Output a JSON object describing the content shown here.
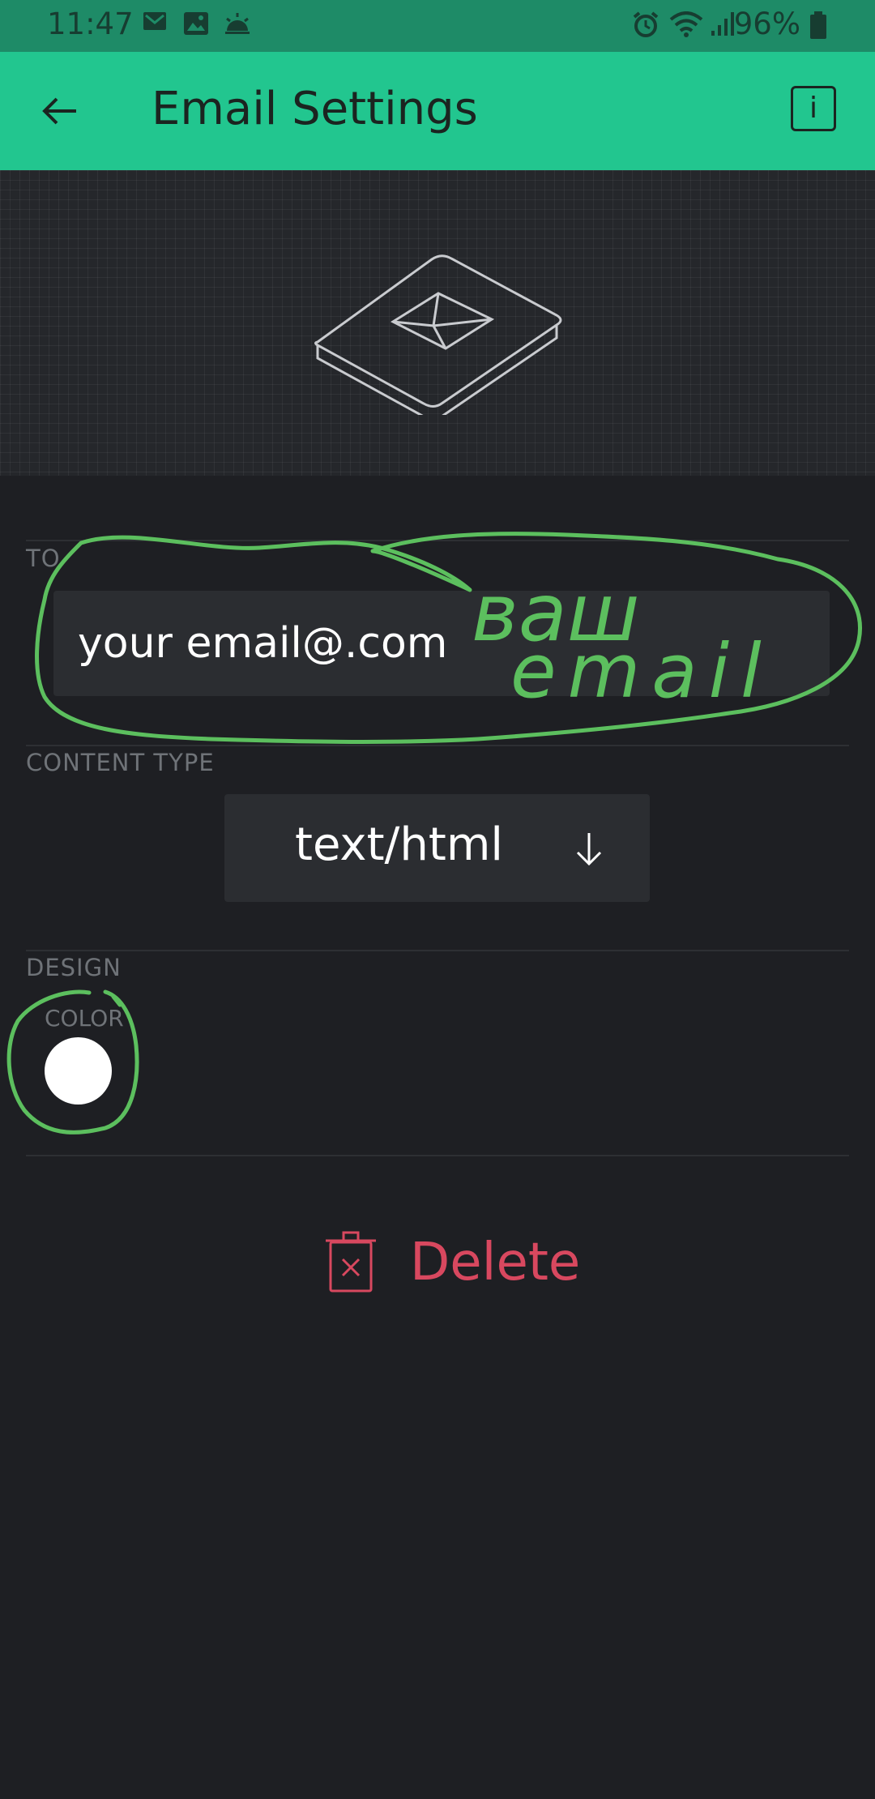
{
  "status_bar": {
    "time": "11:47",
    "battery": "96%",
    "icons": [
      "gmail-icon",
      "gallery-icon",
      "weather-icon",
      "alarm-icon",
      "wifi-icon",
      "signal-icon",
      "battery-icon"
    ]
  },
  "app_bar": {
    "title": "Email Settings",
    "back_icon": "arrow-left-icon",
    "info_label": "i",
    "color": "#22c68f"
  },
  "to_section": {
    "label": "TO",
    "value": "your email@.com"
  },
  "content_type_section": {
    "label": "CONTENT TYPE",
    "selected": "text/html"
  },
  "design_section": {
    "label": "DESIGN",
    "color_label": "COLOR",
    "color_value": "#ffffff"
  },
  "delete": {
    "label": "Delete",
    "color": "#d8485f"
  },
  "annotation": {
    "text_line1": "ваш",
    "text_line2": "email",
    "color": "#5cbf5e"
  }
}
